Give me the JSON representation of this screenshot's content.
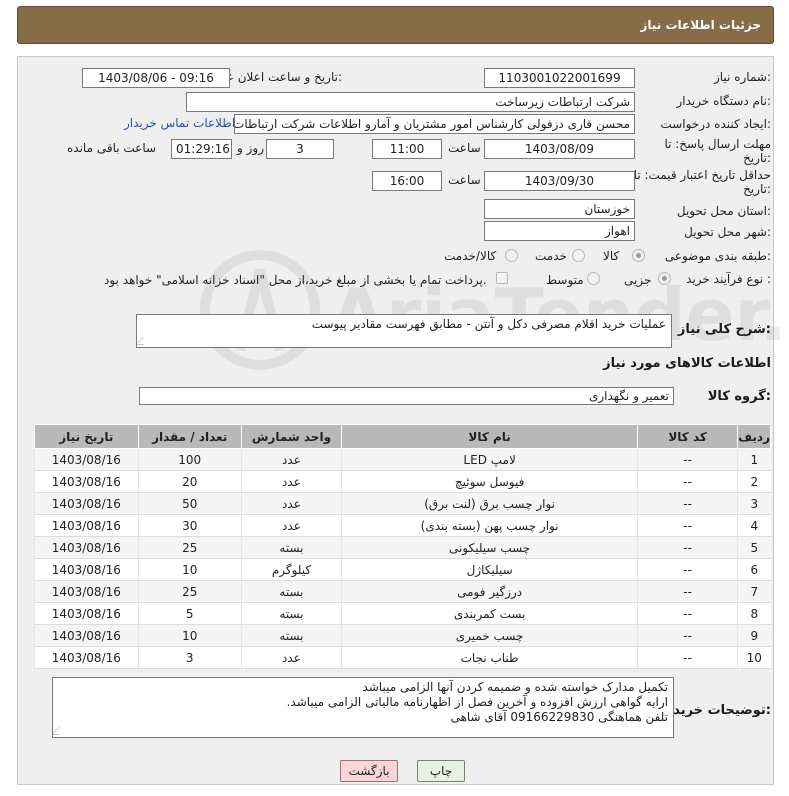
{
  "header": {
    "title": "جزئیات اطلاعات نیاز"
  },
  "fields": {
    "need_number_label": "شماره نیاز:",
    "need_number": "1103001022001699",
    "announce_label": "تاریخ و ساعت اعلان عمومی:",
    "announce_value": "1403/08/06 - 09:16",
    "buyer_label": "نام دستگاه خریدار:",
    "buyer_value": "شرکت ارتباطات زیرساخت",
    "creator_label": "ایجاد کننده درخواست:",
    "creator_value": "محسن قاری دزفولی کارشناس امور مشتریان و آمارو اطلاعات شرکت ارتباطات زیر",
    "contact_link": "اطلاعات تماس خریدار",
    "deadline_label_1": "مهلت ارسال پاسخ: تا",
    "deadline_label_2": "تاریخ:",
    "deadline_date": "1403/08/09",
    "time_label": "ساعت",
    "deadline_time": "11:00",
    "days_value": "3",
    "days_label": "روز و",
    "remaining_time": "01:29:16",
    "remaining_label": "ساعت باقی مانده",
    "validity_label_1": "حداقل تاریخ اعتبار قیمت: تا",
    "validity_label_2": "تاریخ:",
    "validity_date": "1403/09/30",
    "validity_time_label": "ساعت",
    "validity_time": "16:00",
    "province_label": "استان محل تحویل:",
    "province_value": "خوزستان",
    "city_label": "شهر محل تحویل:",
    "city_value": "اهواز",
    "category_label": "طبقه بندی موضوعی:",
    "category_options": [
      "کالا",
      "خدمت",
      "کالا/خدمت"
    ],
    "category_selected": "کالا",
    "process_label": "نوع فرآیند خرید :",
    "process_options": [
      "جزیی",
      "متوسط"
    ],
    "process_selected": "جزیی",
    "payment_note": "پرداخت تمام یا بخشی از مبلغ خرید،از محل \"اسناد خزانه اسلامی\" خواهد بود.",
    "description_label": "شرح کلی نیاز:",
    "description_value": "عملیات خرید اقلام مصرفی دکل و آنتن - مطابق فهرست مقادیر پیوست",
    "goods_info_label": "اطلاعات کالاهای مورد نیاز",
    "goods_group_label": "گروه کالا:",
    "goods_group_value": "تعمیر و نگهداری"
  },
  "table": {
    "headers": [
      "ردیف",
      "کد کالا",
      "نام کالا",
      "واحد شمارش",
      "تعداد / مقدار",
      "تاریخ نیاز"
    ],
    "rows": [
      [
        "1",
        "--",
        "لامپ LED",
        "عدد",
        "100",
        "1403/08/16"
      ],
      [
        "2",
        "--",
        "فیوسل سوئیچ",
        "عدد",
        "20",
        "1403/08/16"
      ],
      [
        "3",
        "--",
        "نوار چسب برق (لنت برق)",
        "عدد",
        "50",
        "1403/08/16"
      ],
      [
        "4",
        "--",
        "نوار چسب پهن (بسته بندی)",
        "عدد",
        "30",
        "1403/08/16"
      ],
      [
        "5",
        "--",
        "چسب سیلیکونی",
        "بسته",
        "25",
        "1403/08/16"
      ],
      [
        "6",
        "--",
        "سیلیکاژل",
        "کیلوگرم",
        "10",
        "1403/08/16"
      ],
      [
        "7",
        "--",
        "درزگیر فومی",
        "بسته",
        "25",
        "1403/08/16"
      ],
      [
        "8",
        "--",
        "بست کمربندی",
        "بسته",
        "5",
        "1403/08/16"
      ],
      [
        "9",
        "--",
        "چسب خمیری",
        "بسته",
        "10",
        "1403/08/16"
      ],
      [
        "10",
        "--",
        "طناب نجات",
        "عدد",
        "3",
        "1403/08/16"
      ]
    ]
  },
  "buyer_notes": {
    "label": "توضیحات خریدار:",
    "lines": [
      "تکمیل مدارک خواسته شده و ضمیمه کردن آنها الزامی میباشد",
      "ارایه گواهی ارزش افزوده و آخرین فصل از اظهارنامه مالیاتی الزامی میباشد.",
      "تلفن هماهنگی  09166229830 آقای شاهی"
    ]
  },
  "buttons": {
    "print": "چاپ",
    "back": "بازگشت"
  },
  "watermark_text": "AriaTender.net",
  "colors": {
    "header": "#866c47",
    "panel": "#efefef",
    "table_header": "#b9b9b9",
    "link": "#1f57a8"
  }
}
